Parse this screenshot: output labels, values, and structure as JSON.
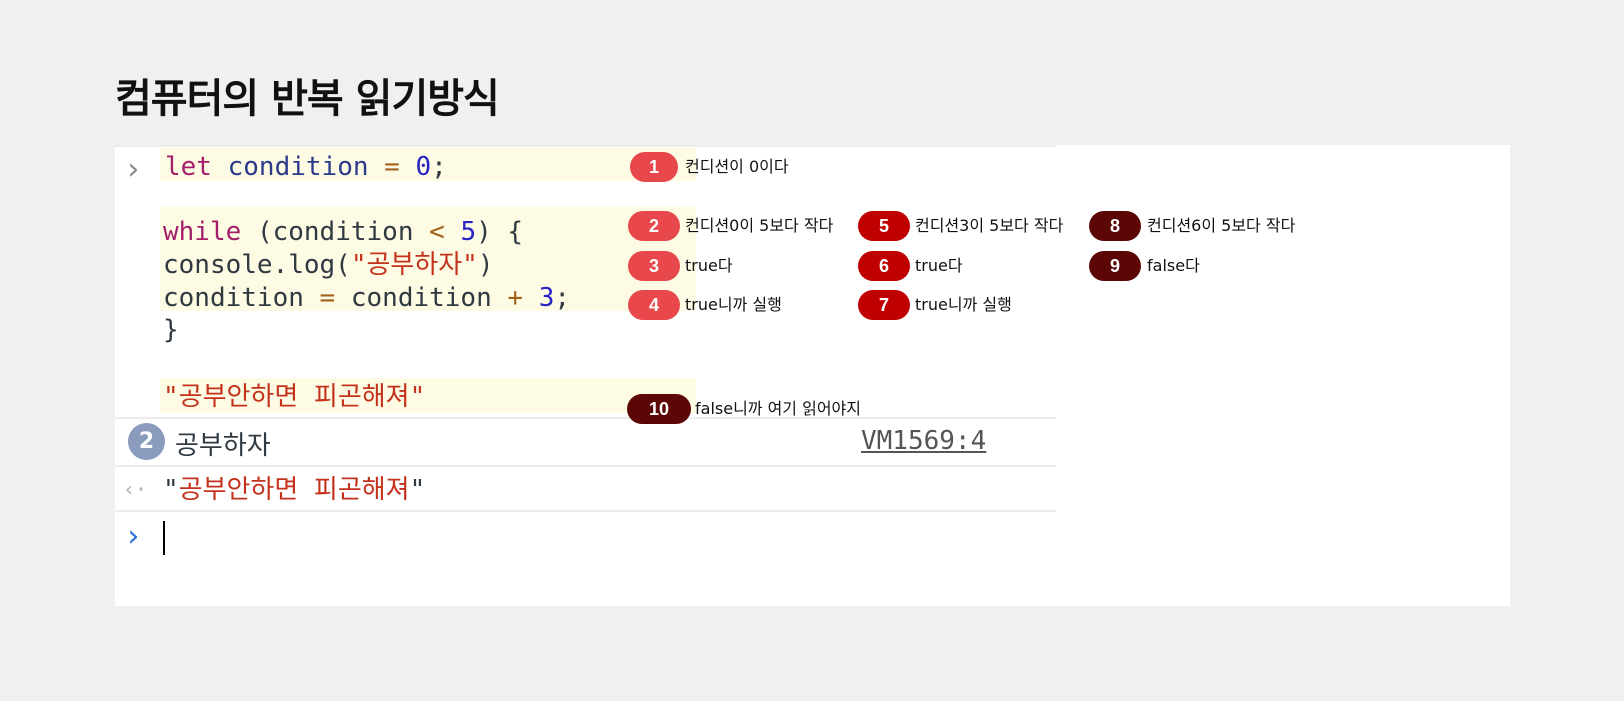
{
  "page": {
    "title": "컴퓨터의 반복 읽기방식"
  },
  "console": {
    "input_prompt": "›",
    "return_prompt": "‹·",
    "active_prompt": "›",
    "code": {
      "line1": {
        "kw": "let",
        "var": "condition",
        "op": "=",
        "num": "0",
        "end": ";"
      },
      "line2": {
        "kw": "while",
        "open": "(condition",
        "op": "<",
        "num": "5",
        "close": ") {"
      },
      "line3": {
        "pre": "console.log(",
        "str": "\"공부하자\"",
        "post": ")"
      },
      "line4": {
        "pre": "condition",
        "op1": "=",
        "mid": "condition",
        "op2": "+",
        "num": "3",
        "end": ";"
      },
      "line5": "}",
      "line6": "\"공부안하면 피곤해져\""
    },
    "log": {
      "count": "2",
      "text": "공부하자",
      "source": "VM1569:4"
    },
    "result": {
      "q1": "\"",
      "str": "공부안하면 피곤해져",
      "q2": "\""
    }
  },
  "steps": [
    {
      "n": "1",
      "text": "컨디션이 0이다",
      "color": "#e8474c"
    },
    {
      "n": "2",
      "text": "컨디션0이 5보다 작다",
      "color": "#e8474c"
    },
    {
      "n": "3",
      "text": "true다",
      "color": "#e8474c"
    },
    {
      "n": "4",
      "text": "true니까 실행",
      "color": "#e8474c"
    },
    {
      "n": "5",
      "text": "컨디션3이 5보다 작다",
      "color": "#c00000"
    },
    {
      "n": "6",
      "text": "true다",
      "color": "#c00000"
    },
    {
      "n": "7",
      "text": "true니까 실행",
      "color": "#c00000"
    },
    {
      "n": "8",
      "text": "컨디션6이 5보다 작다",
      "color": "#5c0606"
    },
    {
      "n": "9",
      "text": "false다",
      "color": "#5c0606"
    },
    {
      "n": "10",
      "text": "false니까 여기 읽어야지",
      "color": "#5c0606"
    }
  ]
}
